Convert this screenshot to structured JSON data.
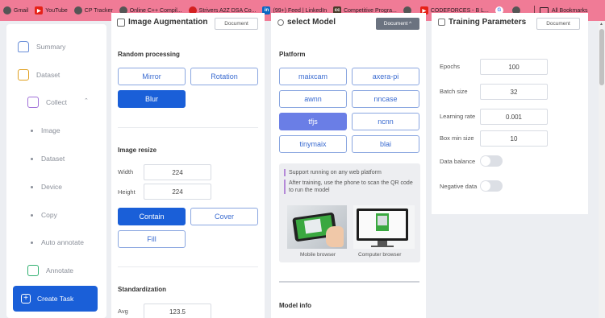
{
  "bookmarks": [
    {
      "label": "Gmail",
      "icon": "globe-icon",
      "color": "#555555"
    },
    {
      "label": "YouTube",
      "icon": "youtube-icon",
      "color": "#e62117"
    },
    {
      "label": "CP Tracker",
      "icon": "globe-icon",
      "color": "#555555"
    },
    {
      "label": "Online C++ Compil...",
      "icon": "globe-icon",
      "color": "#555555"
    },
    {
      "label": "Strivers A2Z DSA Co...",
      "icon": "striver-icon",
      "color": "#d42020"
    },
    {
      "label": "(99+) Feed | LinkedIn",
      "icon": "linkedin-icon",
      "color": "#0a66c2"
    },
    {
      "label": "Competitive Progra...",
      "icon": "cc-icon",
      "color": "#4a3a2a"
    },
    {
      "label": "",
      "icon": "globe-icon",
      "color": "#555555"
    },
    {
      "label": "CODEFORCES - B L...",
      "icon": "youtube-icon",
      "color": "#e62117"
    },
    {
      "label": "",
      "icon": "google-icon",
      "color": "#ffffff"
    },
    {
      "label": "",
      "icon": "globe-icon",
      "color": "#555555"
    }
  ],
  "all_bookmarks": "All Bookmarks",
  "sidebar": {
    "summary": "Summary",
    "dataset": "Dataset",
    "collect": "Collect",
    "sub": [
      "Image",
      "Dataset",
      "Device",
      "Copy",
      "Auto annotate"
    ],
    "annotate": "Annotate",
    "create_task": "Create Task"
  },
  "augment": {
    "title": "Image Augmentation",
    "doc_btn": "Document",
    "random_processing": "Random processing",
    "mirror": "Mirror",
    "rotation": "Rotation",
    "blur": "Blur",
    "image_resize": "Image resize",
    "width_label": "Width",
    "width_value": "224",
    "height_label": "Height",
    "height_value": "224",
    "contain": "Contain",
    "cover": "Cover",
    "fill": "Fill",
    "standardization": "Standardization",
    "avg_label": "Avg",
    "avg_value": "123.5"
  },
  "model": {
    "title": "select Model",
    "doc_btn": "Document ^",
    "platform": "Platform",
    "platforms": [
      "maixcam",
      "axera-pi",
      "awnn",
      "nncase",
      "tfjs",
      "ncnn",
      "tinymaix",
      "blai"
    ],
    "selected": "tfjs",
    "info1": "Support running on any web platform",
    "info2": "After training, use the phone to scan the QR code to run the model",
    "cap_mobile": "Mobile browser",
    "cap_computer": "Computer browser",
    "model_info": "Model info"
  },
  "training": {
    "title": "Training Parameters",
    "doc_btn": "Document",
    "epochs_label": "Epochs",
    "epochs_value": "100",
    "batch_label": "Batch size",
    "batch_value": "32",
    "lr_label": "Learning rate",
    "lr_value": "0.001",
    "box_label": "Box min size",
    "box_value": "10",
    "balance_label": "Data balance",
    "negative_label": "Negative data"
  },
  "colors": {
    "accent": "#1a5fd8",
    "selected_platform": "#6a7ee6",
    "bookmark_bar": "#f07b96"
  }
}
